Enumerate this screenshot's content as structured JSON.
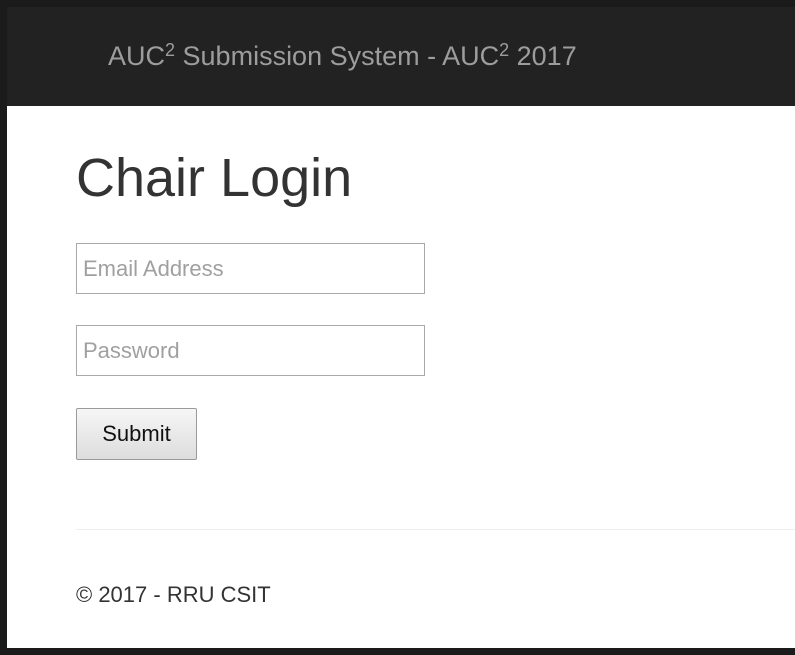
{
  "navbar": {
    "brand_prefix": "AUC",
    "brand_sup_1": "2",
    "brand_middle": " Submission System - AUC",
    "brand_sup_2": "2",
    "brand_suffix": " 2017",
    "background_color": "#222222",
    "text_color": "#9d9d9d"
  },
  "main": {
    "title": "Chair Login",
    "email_placeholder": "Email Address",
    "email_value": "",
    "password_placeholder": "Password",
    "password_value": "",
    "submit_label": "Submit"
  },
  "footer": {
    "text": "© 2017 - RRU CSIT"
  }
}
